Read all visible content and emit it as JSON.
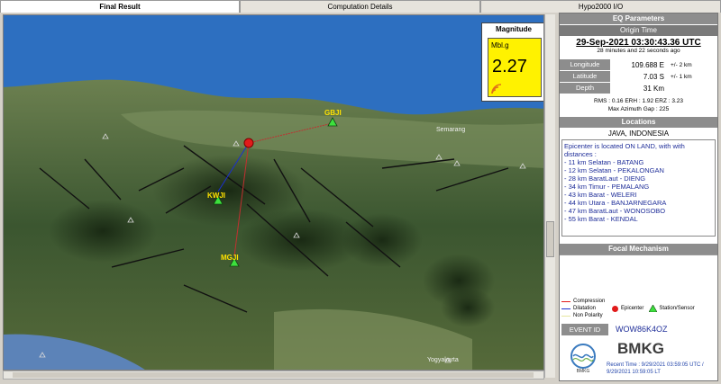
{
  "tabs": [
    "Final Result",
    "Computation Details",
    "Hypo2000 I/O"
  ],
  "magnitude": {
    "title": "Magnitude",
    "type": "Mbl.g",
    "value": "2.27"
  },
  "map": {
    "stations": [
      "GBJI",
      "KWJI",
      "MGJI"
    ],
    "places": [
      "Semarang",
      "Yogyakarta"
    ]
  },
  "eq": {
    "title": "EQ Parameters",
    "origin_title": "Origin Time",
    "origin_time": "29-Sep-2021 03:30:43.36 UTC",
    "ago": "28 minutes and 22 seconds  ago",
    "longitude_label": "Longitude",
    "longitude": "109.688 E",
    "longitude_err": "+/- 2 km",
    "latitude_label": "Latitude",
    "latitude": "7.03 S",
    "latitude_err": "+/- 1 km",
    "depth_label": "Depth",
    "depth": "31 Km",
    "stats": "RMS : 0.16  ERH : 1.92  ERZ : 3.23",
    "gap": "Max Azimuth Gap : 225"
  },
  "locations": {
    "title": "Locations",
    "region": "JAVA, INDONESIA",
    "intro": "Epicenter is located ON LAND, with with distances :",
    "items": [
      "11 km Selatan - BATANG",
      "12 km Selatan - PEKALONGAN",
      "28 km BaratLaut - DIENG",
      "34 km Timur - PEMALANG",
      "43 km Barat - WELERI",
      "44 km Utara - BANJARNEGARA",
      "47 km BaratLaut - WONOSOBO",
      "55 km Barat - KENDAL"
    ]
  },
  "focal": {
    "title": "Focal Mechanism"
  },
  "legend": {
    "compression": "Compression",
    "dilatation": "Dilatation",
    "non_polarity": "Non Polarity",
    "epicenter": "Epicenter",
    "station": "Station/Sensor"
  },
  "event": {
    "label": "EVENT ID",
    "id": "WOW86K4OZ"
  },
  "footer": {
    "org": "BMKG",
    "logo_text": "BMKG",
    "recent_line1": "Recent Time : 9/29/2021 03:59:05 UTC /",
    "recent_line2": "9/29/2021 10:59:05 LT"
  },
  "colors": {
    "sea": "#2d6fc0",
    "land": "#3f5a2e",
    "magnitude_bg": "#fff200",
    "epicenter": "#e11b1b",
    "station": "#3de03d"
  }
}
